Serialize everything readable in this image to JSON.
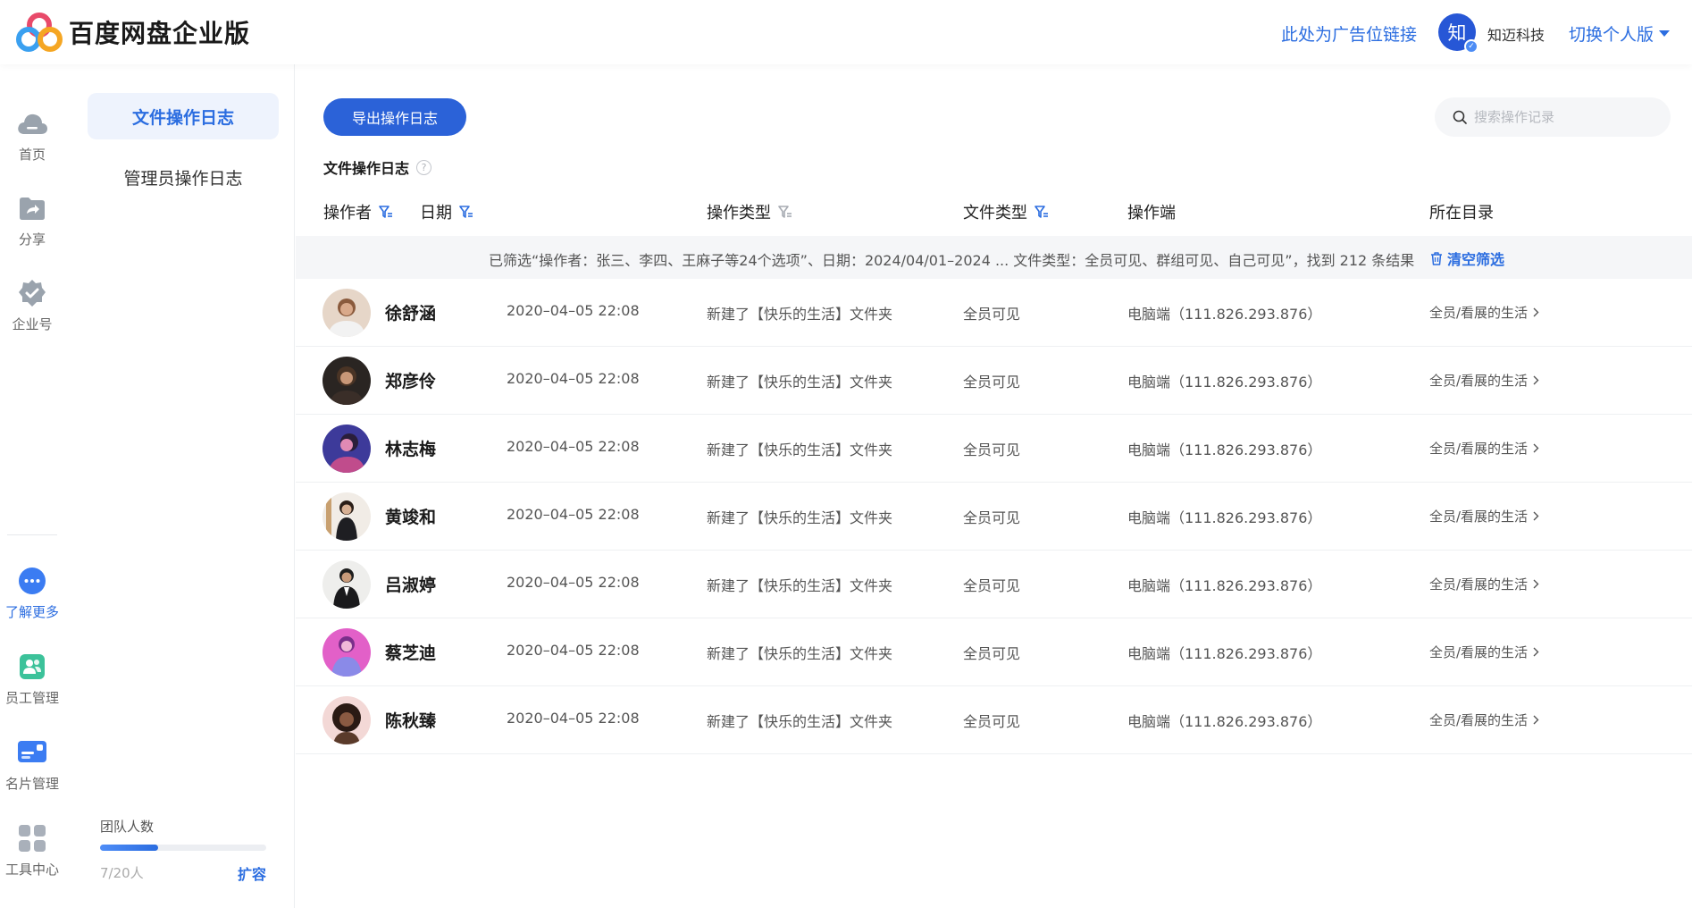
{
  "header": {
    "brand": "百度网盘企业版",
    "ad_link": "此处为广告位链接",
    "org_avatar_char": "知",
    "org_name": "知迈科技",
    "switch_label": "切换个人版"
  },
  "rail": {
    "items": [
      {
        "label": "首页",
        "icon": "cloud-icon"
      },
      {
        "label": "分享",
        "icon": "share-folder-icon"
      },
      {
        "label": "企业号",
        "icon": "verified-badge-icon"
      },
      {
        "label": "了解更多",
        "icon": "more-dots-icon"
      },
      {
        "label": "员工管理",
        "icon": "staff-icon"
      },
      {
        "label": "名片管理",
        "icon": "card-icon"
      },
      {
        "label": "工具中心",
        "icon": "tools-grid-icon"
      }
    ]
  },
  "subnav": {
    "items": [
      {
        "label": "文件操作日志",
        "active": true
      },
      {
        "label": "管理员操作日志",
        "active": false
      }
    ],
    "quota": {
      "label": "团队人数",
      "count": "7/20人",
      "used": 7,
      "total": 20,
      "expand_label": "扩容"
    }
  },
  "main": {
    "export_label": "导出操作日志",
    "search_placeholder": "搜索操作记录",
    "section_title": "文件操作日志",
    "help_mark": "?",
    "columns": [
      {
        "label": "操作者",
        "filter": true,
        "filter_active": true
      },
      {
        "label": "日期",
        "filter": true,
        "filter_active": true
      },
      {
        "label": "操作类型",
        "filter": true,
        "filter_active": false
      },
      {
        "label": "文件类型",
        "filter": true,
        "filter_active": true
      },
      {
        "label": "操作端",
        "filter": false
      },
      {
        "label": "所在目录",
        "filter": false
      }
    ],
    "filter_summary": "已筛选“操作者：张三、李四、王麻子等24个选项”、日期：2024/04/01–2024 ... 文件类型：全员可见、群组可见、自己可见”，找到 212 条结果",
    "clear_label": "清空筛选",
    "rows": [
      {
        "name": "徐舒涵",
        "date": "2020–04–05 22:08",
        "op": "新建了【快乐的生活】文件夹",
        "ftype": "全员可见",
        "client": "电脑端（111.826.293.876）",
        "dir": "全员/看展的生活"
      },
      {
        "name": "郑彦伶",
        "date": "2020–04–05 22:08",
        "op": "新建了【快乐的生活】文件夹",
        "ftype": "全员可见",
        "client": "电脑端（111.826.293.876）",
        "dir": "全员/看展的生活"
      },
      {
        "name": "林志梅",
        "date": "2020–04–05 22:08",
        "op": "新建了【快乐的生活】文件夹",
        "ftype": "全员可见",
        "client": "电脑端（111.826.293.876）",
        "dir": "全员/看展的生活"
      },
      {
        "name": "黄竣和",
        "date": "2020–04–05 22:08",
        "op": "新建了【快乐的生活】文件夹",
        "ftype": "全员可见",
        "client": "电脑端（111.826.293.876）",
        "dir": "全员/看展的生活"
      },
      {
        "name": "吕淑婷",
        "date": "2020–04–05 22:08",
        "op": "新建了【快乐的生活】文件夹",
        "ftype": "全员可见",
        "client": "电脑端（111.826.293.876）",
        "dir": "全员/看展的生活"
      },
      {
        "name": "蔡芝迪",
        "date": "2020–04–05 22:08",
        "op": "新建了【快乐的生活】文件夹",
        "ftype": "全员可见",
        "client": "电脑端（111.826.293.876）",
        "dir": "全员/看展的生活"
      },
      {
        "name": "陈秋臻",
        "date": "2020–04–05 22:08",
        "op": "新建了【快乐的生活】文件夹",
        "ftype": "全员可见",
        "client": "电脑端（111.826.293.876）",
        "dir": "全员/看展的生活"
      }
    ]
  },
  "colors": {
    "accent": "#2b6de0",
    "button": "#2b62d8",
    "filter_bar_bg": "#f5f6f8",
    "active_nav_bg": "#eef3fd"
  }
}
